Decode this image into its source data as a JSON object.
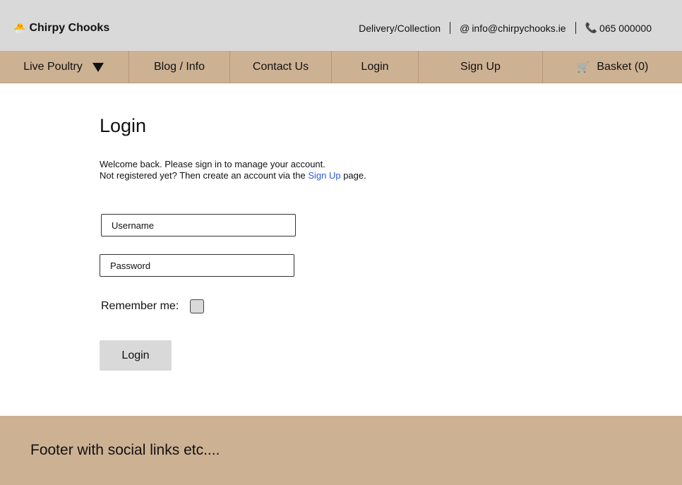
{
  "header": {
    "brand_icon": "🐣",
    "brand_name": "Chirpy Chooks",
    "delivery": "Delivery/Collection",
    "email_icon": "@",
    "email": "info@chirpychooks.ie",
    "phone_icon": "📞",
    "phone": "065 000000"
  },
  "nav": {
    "live_poultry": "Live Poultry",
    "blog": "Blog / Info",
    "contact": "Contact Us",
    "login": "Login",
    "signup": "Sign Up",
    "basket_icon": "🛒",
    "basket": "Basket (0)"
  },
  "login": {
    "title": "Login",
    "welcome": "Welcome back. Please sign in to manage your account.",
    "not_registered_pre": "Not registered yet? Then create an account via the ",
    "signup_link": "Sign Up",
    "not_registered_post": " page.",
    "username_placeholder": "Username",
    "password_placeholder": "Password",
    "remember_label": "Remember me:",
    "remember_checked": false,
    "button": "Login"
  },
  "footer": {
    "text": "Footer with social links etc...."
  }
}
